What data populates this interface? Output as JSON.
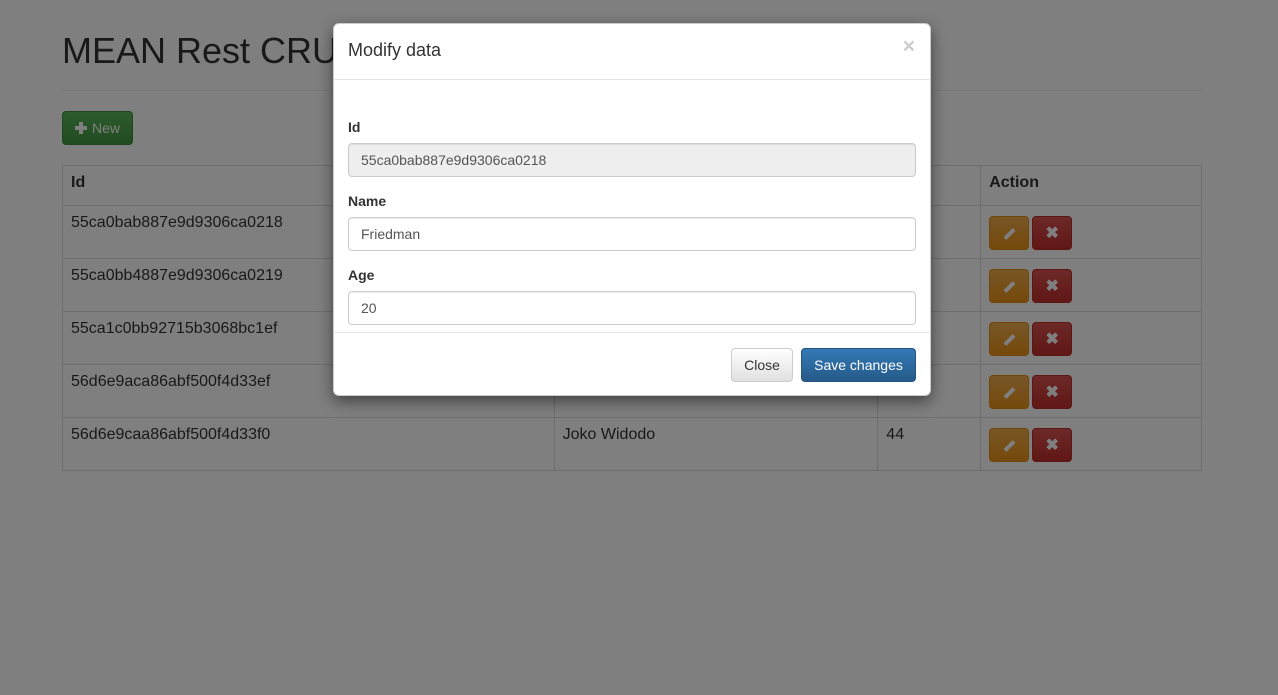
{
  "page": {
    "title": "MEAN Rest CRUD",
    "new_button_label": "New"
  },
  "table": {
    "headers": {
      "id": "Id",
      "name": "",
      "age": "",
      "action": "Action"
    },
    "rows": [
      {
        "id": "55ca0bab887e9d9306ca0218",
        "name": "",
        "age": ""
      },
      {
        "id": "55ca0bb4887e9d9306ca0219",
        "name": "",
        "age": ""
      },
      {
        "id": "55ca1c0bb92715b3068bc1ef",
        "name": "",
        "age": ""
      },
      {
        "id": "56d6e9aca86abf500f4d33ef",
        "name": "",
        "age": ""
      },
      {
        "id": "56d6e9caa86abf500f4d33f0",
        "name": "Joko Widodo",
        "age": "44"
      }
    ]
  },
  "modal": {
    "title": "Modify data",
    "close_symbol": "×",
    "fields": {
      "id_label": "Id",
      "id_value": "55ca0bab887e9d9306ca0218",
      "name_label": "Name",
      "name_value": "Friedman",
      "age_label": "Age",
      "age_value": "20"
    },
    "close_button_label": "Close",
    "save_button_label": "Save changes"
  },
  "icons": {
    "new": "plus-icon",
    "edit": "pencil-icon",
    "delete": "remove-icon"
  },
  "colors": {
    "success": "#5cb85c",
    "warning": "#f0ad4e",
    "danger": "#d9534f",
    "primary": "#337ab7"
  }
}
